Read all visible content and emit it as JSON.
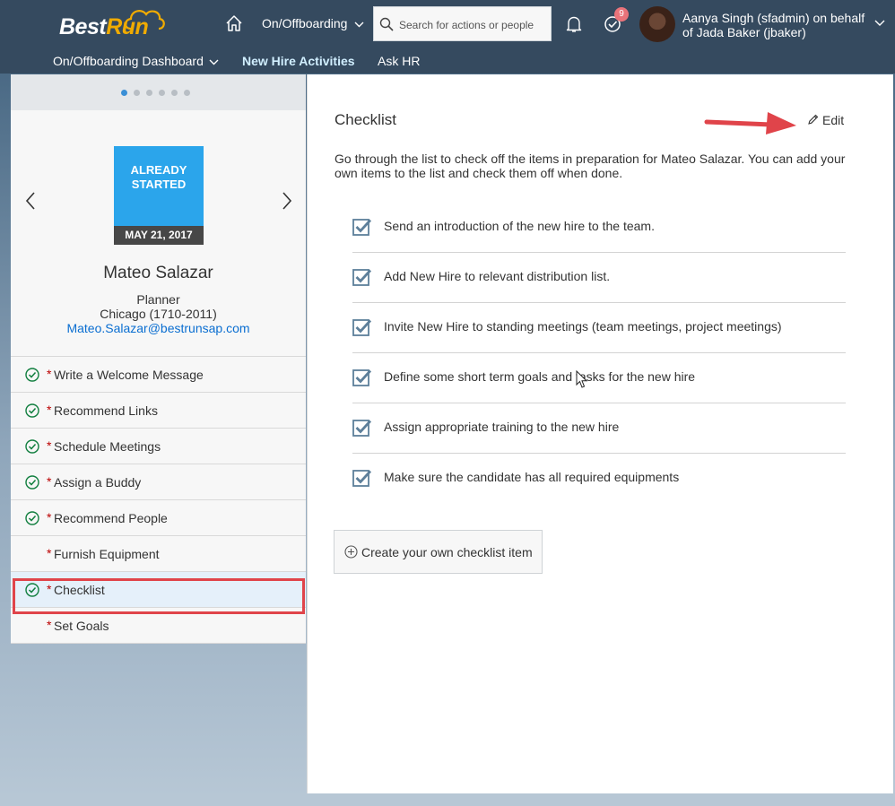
{
  "header": {
    "logo_text_best": "Best",
    "logo_text_run": "Run",
    "module_menu_label": "On/Offboarding",
    "search_placeholder": "Search for actions or people",
    "todo_badge_count": "9",
    "user_line": "Aanya Singh (sfadmin) on behalf of Jada Baker (jbaker)"
  },
  "subnav": {
    "items": [
      {
        "label": "On/Offboarding Dashboard",
        "dropdown": true
      },
      {
        "label": "New Hire Activities",
        "active": true
      },
      {
        "label": "Ask HR"
      }
    ]
  },
  "carousel": {
    "dot_count": 6,
    "active_index": 0
  },
  "profile": {
    "status_line1": "ALREADY",
    "status_line2": "STARTED",
    "status_date": "MAY 21, 2017",
    "name": "Mateo Salazar",
    "role": "Planner",
    "location": "Chicago (1710-2011)",
    "email": "Mateo.Salazar@bestrunsap.com"
  },
  "activities": [
    {
      "label": "Write a Welcome Message",
      "done": true,
      "required": true
    },
    {
      "label": "Recommend Links",
      "done": true,
      "required": true
    },
    {
      "label": "Schedule Meetings",
      "done": true,
      "required": true
    },
    {
      "label": "Assign a Buddy",
      "done": true,
      "required": true
    },
    {
      "label": "Recommend People",
      "done": true,
      "required": true
    },
    {
      "label": "Furnish Equipment",
      "done": false,
      "required": true
    },
    {
      "label": "Checklist",
      "done": true,
      "required": true,
      "selected": true
    },
    {
      "label": "Set Goals",
      "done": false,
      "required": true
    }
  ],
  "checklist_panel": {
    "title": "Checklist",
    "edit_label": "Edit",
    "description": "Go through the list to check off the items in preparation for Mateo Salazar. You can add your own items to the list and check them off when done.",
    "items": [
      {
        "text": "Send an introduction of the new hire to the team.",
        "checked": true
      },
      {
        "text": "Add New Hire to relevant distribution list.",
        "checked": true
      },
      {
        "text": "Invite New Hire to standing meetings (team meetings, project meetings)",
        "checked": true
      },
      {
        "text": "Define some short term goals and tasks for the new hire",
        "checked": true
      },
      {
        "text": "Assign appropriate training to the new hire",
        "checked": true
      },
      {
        "text": "Make sure the candidate has all required equipments",
        "checked": true
      }
    ],
    "create_label": "Create your own checklist item"
  },
  "colors": {
    "shell": "#354a5f",
    "accent": "#2ba5eb",
    "link": "#0a6ed1",
    "success": "#107e3e",
    "required": "#bb0000",
    "annotation": "#e0444a"
  }
}
